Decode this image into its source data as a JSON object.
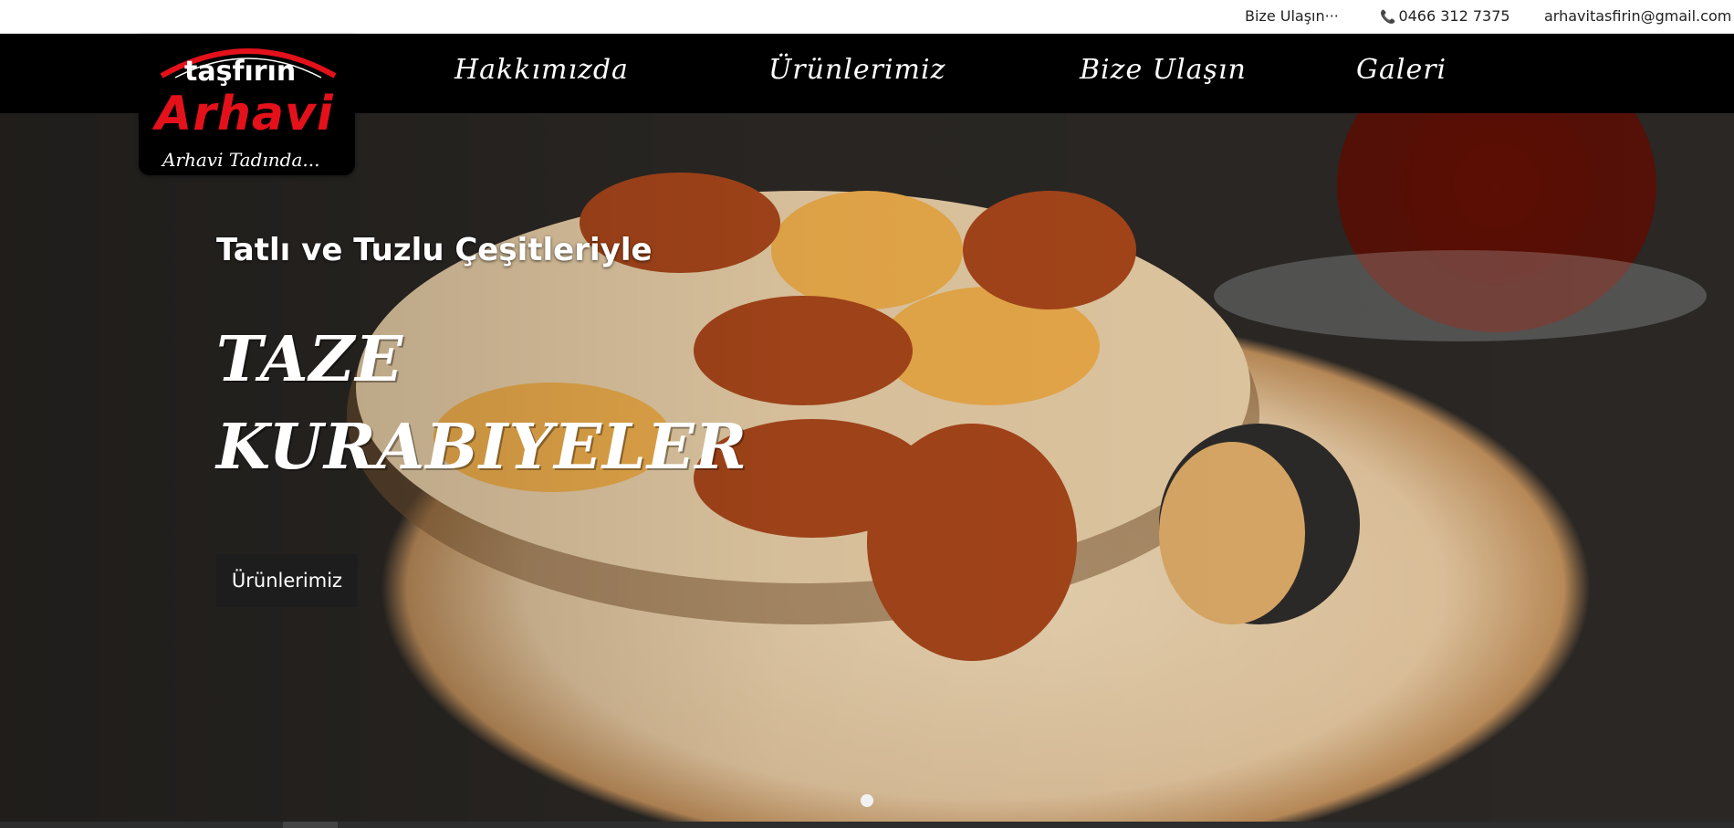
{
  "topbar": {
    "contact_label": "Bize Ulaşın···",
    "phone": "0466 312 7375",
    "email": "arhavitasfirin@gmail.com"
  },
  "logo": {
    "top_text": "taşfırın",
    "brand": "Arhavi",
    "tagline": "Arhavi Tadında..."
  },
  "nav": {
    "items": [
      "Hakkımızda",
      "Ürünlerimiz",
      "Bize Ulaşın",
      "Galeri"
    ]
  },
  "hero": {
    "subtitle": "Tatlı ve Tuzlu Çeşitleriyle",
    "title_line1": "TAZE",
    "title_line2": "KURABIYELER",
    "button_label": "Ürünlerimiz"
  },
  "colors": {
    "navbar": "#000000",
    "logo_red": "#e4111b",
    "button_bg": "#1d1d1d"
  }
}
